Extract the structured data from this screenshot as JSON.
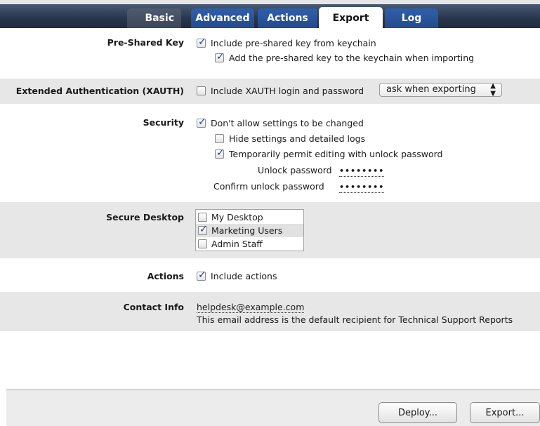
{
  "tabs": [
    {
      "label": "Basic"
    },
    {
      "label": "Advanced"
    },
    {
      "label": "Actions"
    },
    {
      "label": "Export",
      "active": true
    },
    {
      "label": "Log"
    }
  ],
  "pre_shared_key": {
    "label": "Pre-Shared Key",
    "include_label": "Include pre-shared key from keychain",
    "include_checked": true,
    "add_label": "Add the pre-shared key to the keychain when importing",
    "add_checked": true
  },
  "xauth": {
    "label": "Extended Authentication (XAUTH)",
    "include_label": "Include XAUTH login and password",
    "include_checked": false,
    "select_value": "ask when exporting"
  },
  "security": {
    "label": "Security",
    "dont_allow_label": "Don't allow settings to be changed",
    "dont_allow_checked": true,
    "hide_label": "Hide settings and detailed logs",
    "hide_checked": false,
    "permit_label": "Temporarily permit editing with unlock password",
    "permit_checked": true,
    "unlock_label": "Unlock password",
    "unlock_value": "••••••••",
    "confirm_label": "Confirm unlock password",
    "confirm_value": "••••••••"
  },
  "secure_desktop": {
    "label": "Secure Desktop",
    "items": [
      {
        "label": "My Desktop",
        "checked": false
      },
      {
        "label": "Marketing Users",
        "checked": true
      },
      {
        "label": "Admin Staff",
        "checked": false
      }
    ]
  },
  "actions": {
    "label": "Actions",
    "include_label": "Include actions",
    "include_checked": true
  },
  "contact": {
    "label": "Contact Info",
    "email": "helpdesk@example.com",
    "note": "This email address is the default recipient for Technical Support Reports"
  },
  "footer": {
    "deploy_label": "Deploy...",
    "export_label": "Export..."
  },
  "colors": {
    "tab_bar": "#2a3850",
    "tab_inactive": "#2f5faa",
    "shaded_row": "#e7e7e7",
    "checkmark": "#1d3f77"
  }
}
